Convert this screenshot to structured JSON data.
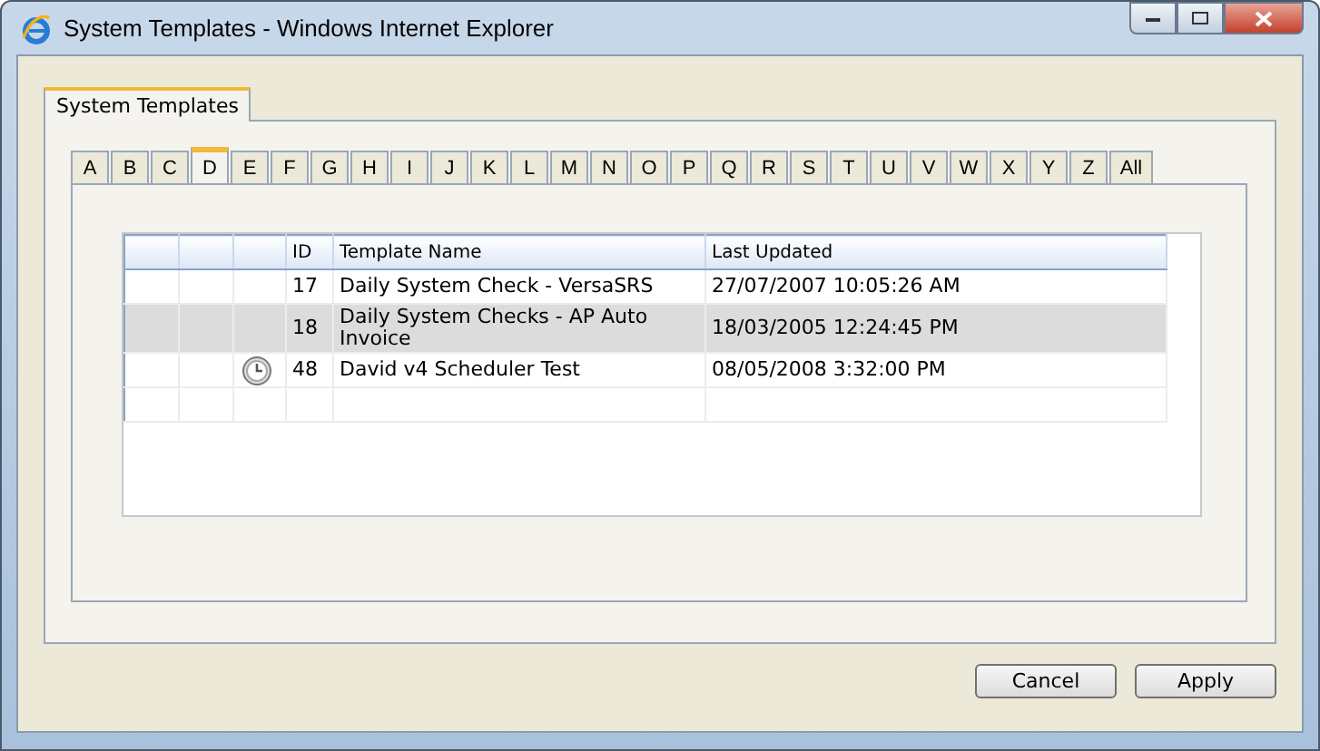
{
  "window": {
    "title": "System Templates - Windows Internet Explorer"
  },
  "outer_tabs": [
    {
      "label": "System Templates",
      "selected": true
    }
  ],
  "letter_tabs": [
    {
      "label": "A",
      "selected": false
    },
    {
      "label": "B",
      "selected": false
    },
    {
      "label": "C",
      "selected": false
    },
    {
      "label": "D",
      "selected": true
    },
    {
      "label": "E",
      "selected": false
    },
    {
      "label": "F",
      "selected": false
    },
    {
      "label": "G",
      "selected": false
    },
    {
      "label": "H",
      "selected": false
    },
    {
      "label": "I",
      "selected": false
    },
    {
      "label": "J",
      "selected": false
    },
    {
      "label": "K",
      "selected": false
    },
    {
      "label": "L",
      "selected": false
    },
    {
      "label": "M",
      "selected": false
    },
    {
      "label": "N",
      "selected": false
    },
    {
      "label": "O",
      "selected": false
    },
    {
      "label": "P",
      "selected": false
    },
    {
      "label": "Q",
      "selected": false
    },
    {
      "label": "R",
      "selected": false
    },
    {
      "label": "S",
      "selected": false
    },
    {
      "label": "T",
      "selected": false
    },
    {
      "label": "U",
      "selected": false
    },
    {
      "label": "V",
      "selected": false
    },
    {
      "label": "W",
      "selected": false
    },
    {
      "label": "X",
      "selected": false
    },
    {
      "label": "Y",
      "selected": false
    },
    {
      "label": "Z",
      "selected": false
    },
    {
      "label": "All",
      "selected": false
    }
  ],
  "table": {
    "columns": [
      "ID",
      "Template Name",
      "Last Updated"
    ],
    "rows": [
      {
        "id": "17",
        "name": "Daily System Check - VersaSRS",
        "updated": "27/07/2007 10:05:26 AM",
        "scheduled": false,
        "selected": false
      },
      {
        "id": "18",
        "name": "Daily System Checks - AP Auto Invoice",
        "updated": "18/03/2005 12:24:45 PM",
        "scheduled": false,
        "selected": true
      },
      {
        "id": "48",
        "name": "David v4 Scheduler Test",
        "updated": "08/05/2008 3:32:00 PM",
        "scheduled": true,
        "selected": false
      }
    ]
  },
  "buttons": [
    "Cancel",
    "Apply"
  ]
}
